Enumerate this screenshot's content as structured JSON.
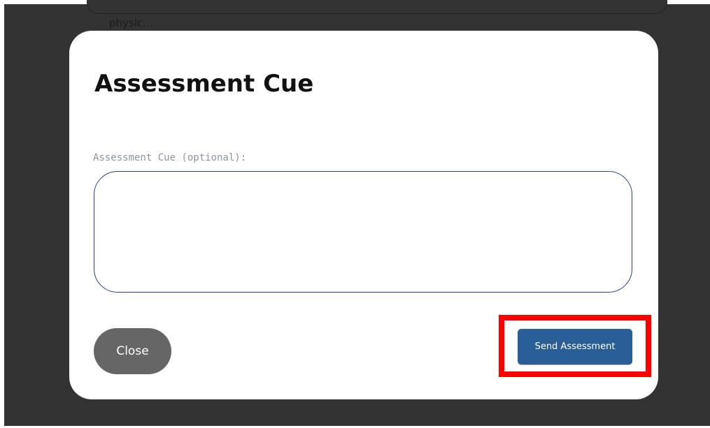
{
  "background": {
    "card_text": "physic..."
  },
  "modal": {
    "title": "Assessment Cue",
    "field_label": "Assessment Cue (optional):",
    "textarea_value": "",
    "textarea_placeholder": "",
    "close_label": "Close",
    "send_label": "Send Assessment"
  },
  "colors": {
    "backdrop": "#333333",
    "primary_button": "#2a5e96",
    "secondary_button": "#666666",
    "highlight": "#ff0000",
    "textarea_border": "#2c3e86"
  }
}
